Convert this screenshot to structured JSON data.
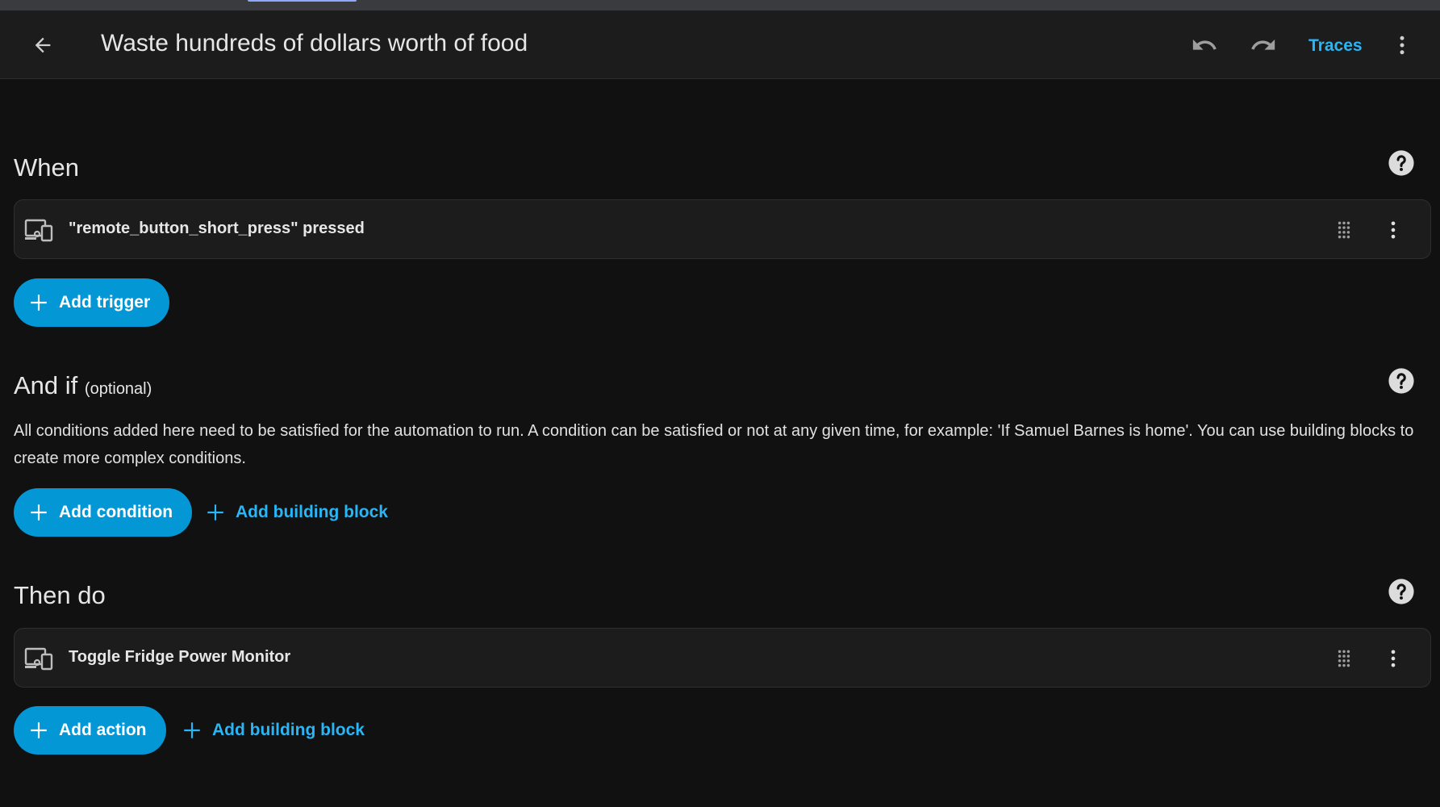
{
  "header": {
    "title": "Waste hundreds of dollars worth of food",
    "traces_label": "Traces",
    "back_icon": "arrow-left-icon",
    "undo_icon": "undo-icon",
    "redo_icon": "redo-icon",
    "menu_icon": "dots-vertical-icon"
  },
  "triggers": {
    "title": "When",
    "items": [
      {
        "label": "\"remote_button_short_press\" pressed",
        "icon": "device-icon"
      }
    ],
    "add_label": "Add trigger"
  },
  "conditions": {
    "title": "And if",
    "optional": "(optional)",
    "description": "All conditions added here need to be satisfied for the automation to run. A condition can be satisfied or not at any given time, for example: 'If Samuel Barnes is home'. You can use building blocks to create more complex conditions.",
    "add_label": "Add condition",
    "add_block_label": "Add building block"
  },
  "actions": {
    "title": "Then do",
    "items": [
      {
        "label": "Toggle Fridge Power Monitor",
        "icon": "device-icon"
      }
    ],
    "add_label": "Add action",
    "add_block_label": "Add building block"
  },
  "colors": {
    "accent": "#0397d6",
    "link": "#29b6f6",
    "background": "#111111",
    "card": "#1c1c1c"
  }
}
